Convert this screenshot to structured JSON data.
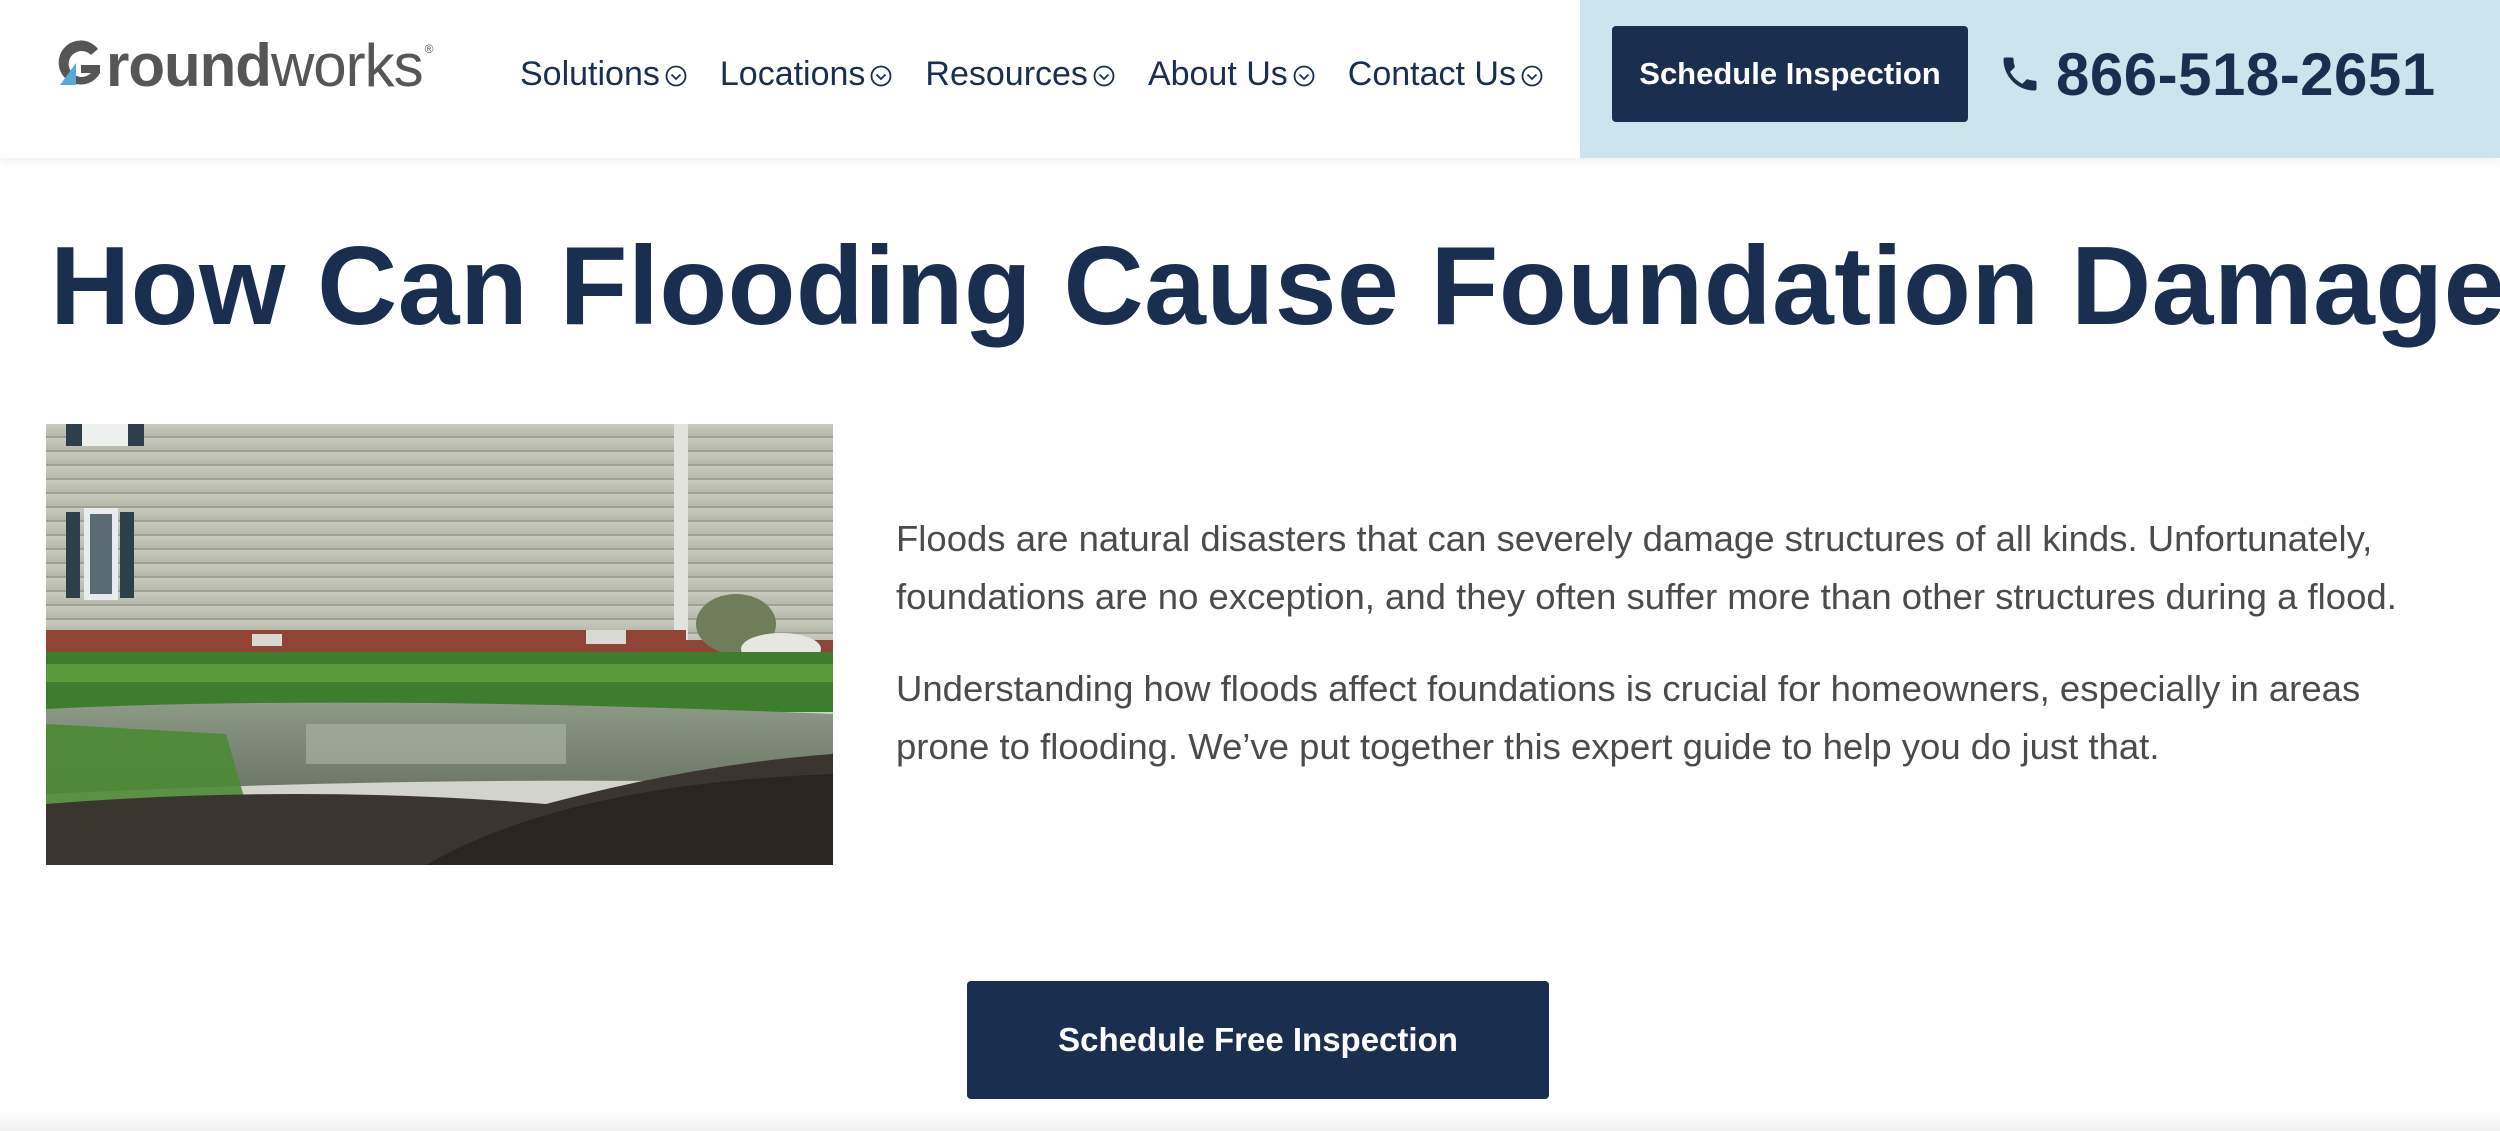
{
  "header": {
    "logo": {
      "text_bold": "Groundworks",
      "text_bold_part": "Groundworks",
      "registered_mark": "®"
    },
    "nav": [
      {
        "label": "Solutions",
        "icon": "chevron-down-circle-icon"
      },
      {
        "label": "Locations",
        "icon": "chevron-down-circle-icon"
      },
      {
        "label": "Resources",
        "icon": "chevron-down-circle-icon"
      },
      {
        "label": "About Us",
        "icon": "chevron-down-circle-icon"
      },
      {
        "label": "Contact Us",
        "icon": "chevron-down-circle-icon"
      }
    ],
    "schedule_button": "Schedule Inspection",
    "phone": {
      "icon": "phone-icon",
      "number": "866-518-2651"
    }
  },
  "main": {
    "title": "How Can Flooding Cause Foundation Damage?",
    "hero_image": {
      "icon": "flooded-yard-photo"
    },
    "paragraphs": [
      "Floods are natural disasters that can severely damage structures of all kinds. Unfortunately, foundations are no exception, and they often suffer more than other structures during a flood.",
      "Understanding how floods affect foundations is crucial for homeowners, especially in areas prone to flooding. We’ve put together this expert guide to help you do just that."
    ],
    "cta_button": "Schedule Free Inspection"
  },
  "colors": {
    "navy": "#1a2e4f",
    "cta_panel": "#cce4ee",
    "body_text": "#4b4b4b",
    "logo_gray": "#565656",
    "logo_accent": "#5aa9d6"
  }
}
